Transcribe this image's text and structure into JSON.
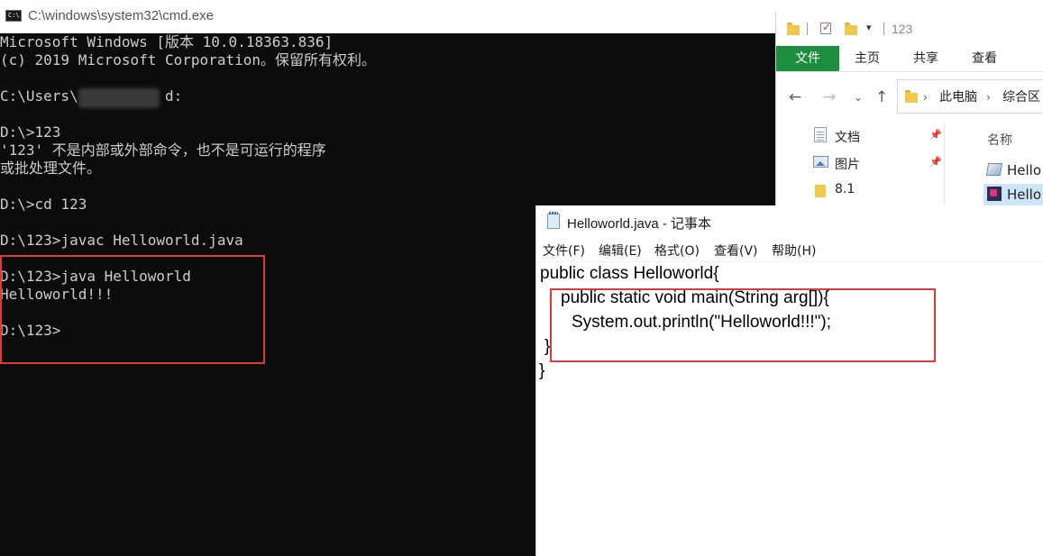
{
  "cmd": {
    "title": "C:\\windows\\system32\\cmd.exe",
    "icon": "cmd-icon",
    "lines": [
      "Microsoft Windows [版本 10.0.18363.836]",
      "(c) 2019 Microsoft Corporation。保留所有权利。",
      "",
      "C:\\Users\\          d:",
      "",
      "D:\\>123",
      "'123' 不是内部或外部命令，也不是可运行的程序",
      "或批处理文件。",
      "",
      "D:\\>cd 123",
      "",
      "D:\\123>javac Helloworld.java",
      "",
      "D:\\123>java Helloworld",
      "Helloworld!!!",
      "",
      "D:\\123>"
    ]
  },
  "explorer": {
    "title": "123",
    "ribbon": {
      "file": "文件",
      "tabs": [
        "主页",
        "共享",
        "查看"
      ]
    },
    "breadcrumb": [
      "此电脑",
      "综合区"
    ],
    "nav_items": [
      {
        "label": "文档",
        "icon": "document-icon",
        "pinned": true
      },
      {
        "label": "图片",
        "icon": "pictures-icon",
        "pinned": true
      },
      {
        "label": "8.1",
        "icon": "folder-icon",
        "pinned": false
      }
    ],
    "column_name": "名称",
    "files": [
      {
        "label": "Hello",
        "icon": "java-file-icon"
      },
      {
        "label": "Hello",
        "icon": "class-file-icon"
      }
    ]
  },
  "notepad": {
    "title": "Helloworld.java - 记事本",
    "menus": [
      "文件(F)",
      "编辑(E)",
      "格式(O)",
      "查看(V)",
      "帮助(H)"
    ],
    "code": [
      "public class Helloworld{",
      "public static void main(String arg[]){",
      "System.out.println(\"Helloworld!!!\");",
      "}",
      "}"
    ]
  },
  "colors": {
    "cmd_bg": "#0c0c0c",
    "cmd_text": "#cccccc",
    "highlight_red": "#d93b3b",
    "ribbon_green": "#1c8f3e"
  }
}
